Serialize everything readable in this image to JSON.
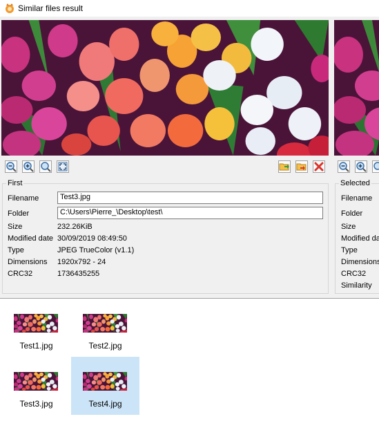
{
  "window": {
    "title": "Similar files result"
  },
  "colors": {
    "selection": "#cce4f7",
    "accent_delete": "#d9342b"
  },
  "toolbar_left": [
    {
      "icon": "zoom-out-icon"
    },
    {
      "icon": "zoom-in-icon"
    },
    {
      "icon": "zoom-fit-icon"
    },
    {
      "icon": "full-size-icon"
    }
  ],
  "toolbar_right": [
    {
      "icon": "open-folder-icon"
    },
    {
      "icon": "move-icon"
    },
    {
      "icon": "delete-icon"
    }
  ],
  "first": {
    "group_label": "First",
    "filename_label": "Filename",
    "filename": "Test3.jpg",
    "folder_label": "Folder",
    "folder": "C:\\Users\\Pierre_\\Desktop\\test\\",
    "size_label": "Size",
    "size": "232.26KiB",
    "modified_label": "Modified date",
    "modified": "30/09/2019 08:49:50",
    "type_label": "Type",
    "type": "JPEG TrueColor (v1.1)",
    "dimensions_label": "Dimensions",
    "dimensions": "1920x792 - 24",
    "crc_label": "CRC32",
    "crc": "1736435255"
  },
  "selected": {
    "group_label": "Selected",
    "filename_label": "Filename",
    "folder_label": "Folder",
    "size_label": "Size",
    "modified_label": "Modified da",
    "type_label": "Type",
    "dimensions_label": "Dimensions",
    "crc_label": "CRC32",
    "similarity_label": "Similarity"
  },
  "files": [
    {
      "name": "Test1.jpg",
      "selected": false
    },
    {
      "name": "Test2.jpg",
      "selected": false
    },
    {
      "name": "Test3.jpg",
      "selected": false
    },
    {
      "name": "Test4.jpg",
      "selected": true
    }
  ]
}
